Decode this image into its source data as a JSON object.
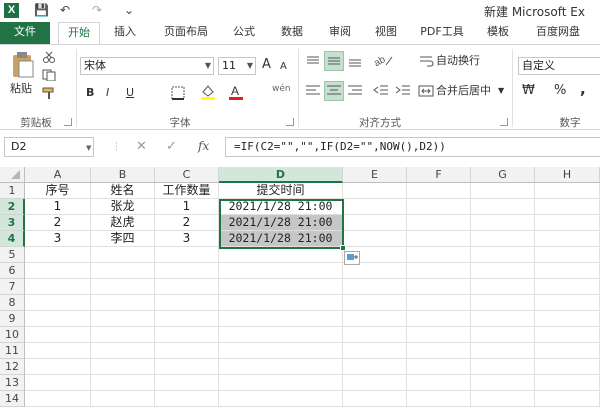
{
  "titlebar": {
    "title": "新建 Microsoft Ex",
    "logo": "X",
    "save_icon": "💾",
    "undo_icon": "↶",
    "redo_icon": "↷",
    "more_icon": "⌄"
  },
  "tabs": [
    "文件",
    "开始",
    "插入",
    "页面布局",
    "公式",
    "数据",
    "审阅",
    "视图",
    "PDF工具",
    "模板",
    "百度网盘"
  ],
  "active_tab": "开始",
  "ribbon": {
    "clipboard": {
      "paste": "粘贴",
      "label": "剪贴板"
    },
    "font": {
      "name": "宋体",
      "size": "11",
      "grow": "A",
      "shrink": "A",
      "bold": "B",
      "italic": "I",
      "underline": "U",
      "wen": "wén",
      "label": "字体",
      "fill_color": "#ffff00",
      "font_color": "#e02020"
    },
    "alignment": {
      "wrap": "自动换行",
      "merge": "合并后居中",
      "label": "对齐方式"
    },
    "number": {
      "format": "自定义",
      "percent": "%",
      "comma": ",",
      "label": "数字",
      "currency": "₩"
    }
  },
  "formula_bar": {
    "name_box": "D2",
    "cancel": "✕",
    "enter": "✓",
    "fx": "fx",
    "formula": "=IF(C2=\"\",\"\",IF(D2=\"\",NOW(),D2))"
  },
  "grid": {
    "columns": [
      "A",
      "B",
      "C",
      "D",
      "E",
      "F",
      "G",
      "H"
    ],
    "rows": [
      "1",
      "2",
      "3",
      "4",
      "5",
      "6",
      "7",
      "8",
      "9",
      "10",
      "11",
      "12",
      "13",
      "14"
    ],
    "data": [
      [
        "序号",
        "姓名",
        "工作数量",
        "提交时间"
      ],
      [
        "1",
        "张龙",
        "1",
        "2021/1/28  21:00"
      ],
      [
        "2",
        "赵虎",
        "2",
        "2021/1/28  21:00"
      ],
      [
        "3",
        "李四",
        "3",
        "2021/1/28  21:00"
      ]
    ]
  }
}
